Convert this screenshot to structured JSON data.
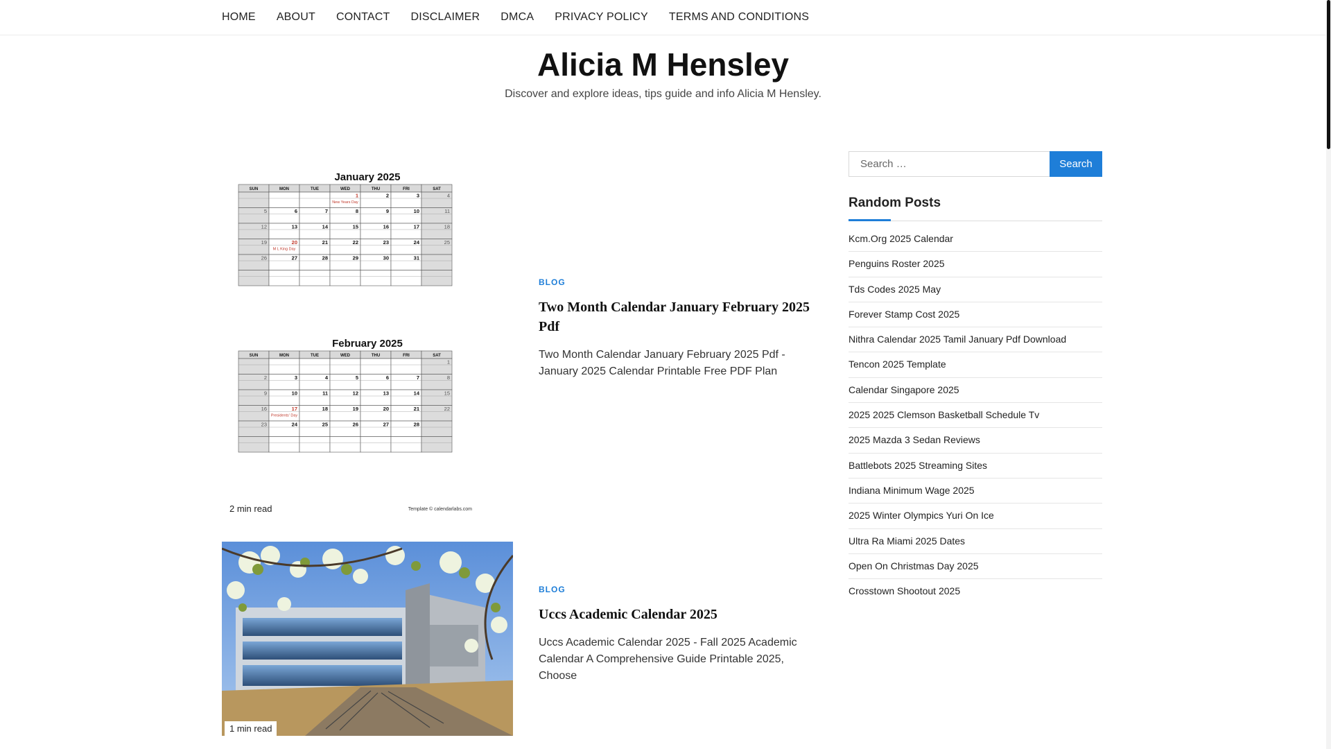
{
  "nav": {
    "items": [
      "HOME",
      "ABOUT",
      "CONTACT",
      "DISCLAIMER",
      "DMCA",
      "PRIVACY POLICY",
      "TERMS AND CONDITIONS"
    ]
  },
  "site": {
    "title": "Alicia M Hensley",
    "description": "Discover and explore ideas, tips guide and info Alicia M Hensley."
  },
  "posts": [
    {
      "category": "BLOG",
      "title": "Two Month Calendar January February 2025 Pdf",
      "excerpt": "Two Month Calendar January February 2025 Pdf - January 2025 Calendar Printable Free PDF Plan",
      "read_time": "2 min read",
      "image": {
        "month1": "January 2025",
        "month2": "February 2025",
        "weekdays": [
          "SUN",
          "MON",
          "TUE",
          "WED",
          "THU",
          "FRI",
          "SAT"
        ],
        "jan_note1": "New Years Day",
        "jan_note2": "M L King Day",
        "feb_note": "Presidents' Day",
        "credit": "Template © calendarlabs.com"
      }
    },
    {
      "category": "BLOG",
      "title": "Uccs Academic Calendar 2025",
      "excerpt": "Uccs Academic Calendar 2025 - Fall 2025 Academic Calendar A Comprehensive Guide Printable 2025, Choose",
      "read_time": "1 min read"
    }
  ],
  "sidebar": {
    "search_placeholder": "Search …",
    "search_button": "Search",
    "widget_title": "Random Posts",
    "random_posts": [
      "Kcm.Org 2025 Calendar",
      "Penguins Roster 2025",
      "Tds Codes 2025 May",
      "Forever Stamp Cost 2025",
      "Nithra Calendar 2025 Tamil January Pdf Download",
      "Tencon 2025 Template",
      "Calendar Singapore 2025",
      "2025 2025 Clemson Basketball Schedule Tv",
      "2025 Mazda 3 Sedan Reviews",
      "Battlebots 2025 Streaming Sites",
      "Indiana Minimum Wage 2025",
      "2025 Winter Olympics Yuri On Ice",
      "Ultra Ra Miami 2025 Dates",
      "Open On Christmas Day 2025",
      "Crosstown Shootout 2025"
    ]
  },
  "colors": {
    "accent": "#1e7ed8",
    "holiday_red": "#c0392b"
  }
}
